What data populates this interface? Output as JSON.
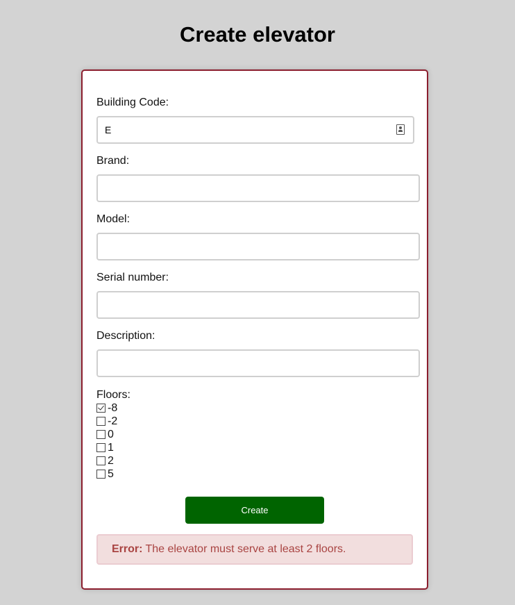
{
  "page": {
    "title": "Create elevator"
  },
  "form": {
    "building_code": {
      "label": "Building Code:",
      "value": "E",
      "icon": "contact-card-icon"
    },
    "brand": {
      "label": "Brand:",
      "value": ""
    },
    "model": {
      "label": "Model:",
      "value": ""
    },
    "serial_number": {
      "label": "Serial number:",
      "value": ""
    },
    "description": {
      "label": "Description:",
      "value": ""
    },
    "floors": {
      "label": "Floors:",
      "options": [
        {
          "label": "-8",
          "checked": true
        },
        {
          "label": "-2",
          "checked": false
        },
        {
          "label": "0",
          "checked": false
        },
        {
          "label": "1",
          "checked": false
        },
        {
          "label": "2",
          "checked": false
        },
        {
          "label": "5",
          "checked": false
        }
      ]
    },
    "submit_label": "Create"
  },
  "error": {
    "prefix": "Error:",
    "message": "The elevator must serve at least 2 floors."
  },
  "colors": {
    "background": "#d3d3d3",
    "card_border": "#8b1e2e",
    "button": "#006400",
    "error_bg": "#f2dede",
    "error_text": "#a94442"
  }
}
